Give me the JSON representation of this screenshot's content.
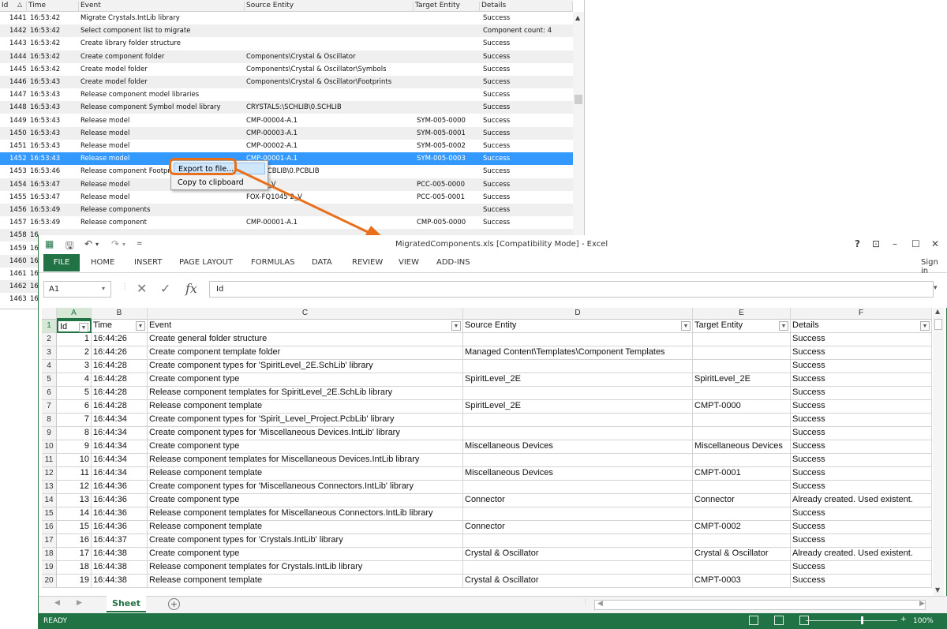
{
  "log": {
    "headers": [
      "Id",
      "Time",
      "Event",
      "Source Entity",
      "Target Entity",
      "Details"
    ],
    "rows": [
      {
        "id": "1441",
        "time": "16:53:42",
        "event": "Migrate Crystals.IntLib library",
        "source": "",
        "target": "",
        "details": "Success"
      },
      {
        "id": "1442",
        "time": "16:53:42",
        "event": "Select component list to migrate",
        "source": "",
        "target": "",
        "details": "Component count: 4"
      },
      {
        "id": "1443",
        "time": "16:53:42",
        "event": "Create library folder structure",
        "source": "",
        "target": "",
        "details": "Success"
      },
      {
        "id": "1444",
        "time": "16:53:42",
        "event": "Create component folder",
        "source": "Components\\Crystal & Oscillator",
        "target": "",
        "details": "Success"
      },
      {
        "id": "1445",
        "time": "16:53:42",
        "event": "Create model folder",
        "source": "Components\\Crystal & Oscillator\\Symbols",
        "target": "",
        "details": "Success"
      },
      {
        "id": "1446",
        "time": "16:53:43",
        "event": "Create model folder",
        "source": "Components\\Crystal & Oscillator\\Footprints",
        "target": "",
        "details": "Success"
      },
      {
        "id": "1447",
        "time": "16:53:43",
        "event": "Release component model libraries",
        "source": "",
        "target": "",
        "details": "Success"
      },
      {
        "id": "1448",
        "time": "16:53:43",
        "event": "Release component Symbol model library",
        "source": "CRYSTALS:\\SCHLIB\\0.SCHLIB",
        "target": "",
        "details": "Success"
      },
      {
        "id": "1449",
        "time": "16:53:43",
        "event": "Release model",
        "source": "CMP-00004-A.1",
        "target": "SYM-005-0000",
        "details": "Success"
      },
      {
        "id": "1450",
        "time": "16:53:43",
        "event": "Release model",
        "source": "CMP-00003-A.1",
        "target": "SYM-005-0001",
        "details": "Success"
      },
      {
        "id": "1451",
        "time": "16:53:43",
        "event": "Release model",
        "source": "CMP-00002-A.1",
        "target": "SYM-005-0002",
        "details": "Success"
      },
      {
        "id": "1452",
        "time": "16:53:43",
        "event": "Release model",
        "source": "CMP-00001-A.1",
        "target": "SYM-005-0003",
        "details": "Success"
      },
      {
        "id": "1453",
        "time": "16:53:46",
        "event": "Release component Footprint",
        "source": "ALS:\\PCBLIB\\0.PCBLIB",
        "target": "",
        "details": "Success"
      },
      {
        "id": "1454",
        "time": "16:53:47",
        "event": "Release model",
        "source": "5032B_V",
        "target": "PCC-005-0000",
        "details": "Success"
      },
      {
        "id": "1455",
        "time": "16:53:47",
        "event": "Release model",
        "source": "FOX-FQ1045 2_V",
        "target": "PCC-005-0001",
        "details": "Success"
      },
      {
        "id": "1456",
        "time": "16:53:49",
        "event": "Release components",
        "source": "",
        "target": "",
        "details": "Success"
      },
      {
        "id": "1457",
        "time": "16:53:49",
        "event": "Release component",
        "source": "CMP-00001-A.1",
        "target": "CMP-005-0000",
        "details": "Success"
      },
      {
        "id": "1458",
        "time": "16",
        "event": "",
        "source": "",
        "target": "",
        "details": ""
      },
      {
        "id": "1459",
        "time": "16",
        "event": "",
        "source": "",
        "target": "",
        "details": ""
      },
      {
        "id": "1460",
        "time": "16",
        "event": "",
        "source": "",
        "target": "",
        "details": ""
      },
      {
        "id": "1461",
        "time": "16",
        "event": "",
        "source": "",
        "target": "",
        "details": ""
      },
      {
        "id": "1462",
        "time": "16",
        "event": "",
        "source": "",
        "target": "",
        "details": ""
      },
      {
        "id": "1463",
        "time": "16",
        "event": "",
        "source": "",
        "target": "",
        "details": ""
      }
    ],
    "selected_row_index": 11,
    "context_menu": [
      "Export to file...",
      "Copy to clipboard"
    ]
  },
  "excel": {
    "title": "MigratedComponents.xls  [Compatibility Mode] - Excel",
    "window_controls": [
      "?",
      "⊡",
      "–",
      "☐",
      "✕"
    ],
    "ribbon_tabs": [
      "FILE",
      "HOME",
      "INSERT",
      "PAGE LAYOUT",
      "FORMULAS",
      "DATA",
      "REVIEW",
      "VIEW",
      "ADD-INS"
    ],
    "sign_in": "Sign in",
    "name_box": "A1",
    "formula": "Id",
    "columns": [
      "A",
      "B",
      "C",
      "D",
      "E",
      "F"
    ],
    "headers": [
      "Id",
      "Time",
      "Event",
      "Source Entity",
      "Target Entity",
      "Details"
    ],
    "rows": [
      [
        "1",
        "16:44:26",
        "Create general folder structure",
        "",
        "",
        "Success"
      ],
      [
        "2",
        "16:44:26",
        "Create component template folder",
        "Managed Content\\Templates\\Component Templates",
        "",
        "Success"
      ],
      [
        "3",
        "16:44:28",
        "Create component types for 'SpiritLevel_2E.SchLib' library",
        "",
        "",
        "Success"
      ],
      [
        "4",
        "16:44:28",
        "Create component type",
        "SpiritLevel_2E",
        "SpiritLevel_2E",
        "Success"
      ],
      [
        "5",
        "16:44:28",
        "Release component templates for SpiritLevel_2E.SchLib library",
        "",
        "",
        "Success"
      ],
      [
        "6",
        "16:44:28",
        "Release component template",
        "SpiritLevel_2E",
        "CMPT-0000",
        "Success"
      ],
      [
        "7",
        "16:44:34",
        "Create component types for 'Spirit_Level_Project.PcbLib' library",
        "",
        "",
        "Success"
      ],
      [
        "8",
        "16:44:34",
        "Create component types for 'Miscellaneous Devices.IntLib' library",
        "",
        "",
        "Success"
      ],
      [
        "9",
        "16:44:34",
        "Create component type",
        "Miscellaneous Devices",
        "Miscellaneous Devices",
        "Success"
      ],
      [
        "10",
        "16:44:34",
        "Release component templates for Miscellaneous Devices.IntLib library",
        "",
        "",
        "Success"
      ],
      [
        "11",
        "16:44:34",
        "Release component template",
        "Miscellaneous Devices",
        "CMPT-0001",
        "Success"
      ],
      [
        "12",
        "16:44:36",
        "Create component types for 'Miscellaneous Connectors.IntLib' library",
        "",
        "",
        "Success"
      ],
      [
        "13",
        "16:44:36",
        "Create component type",
        "Connector",
        "Connector",
        "Already created. Used existent."
      ],
      [
        "14",
        "16:44:36",
        "Release component templates for Miscellaneous Connectors.IntLib library",
        "",
        "",
        "Success"
      ],
      [
        "15",
        "16:44:36",
        "Release component template",
        "Connector",
        "CMPT-0002",
        "Success"
      ],
      [
        "16",
        "16:44:37",
        "Create component types for 'Crystals.IntLib' library",
        "",
        "",
        "Success"
      ],
      [
        "17",
        "16:44:38",
        "Create component type",
        "Crystal & Oscillator",
        "Crystal & Oscillator",
        "Already created. Used existent."
      ],
      [
        "18",
        "16:44:38",
        "Release component templates for Crystals.IntLib library",
        "",
        "",
        "Success"
      ],
      [
        "19",
        "16:44:38",
        "Release component template",
        "Crystal & Oscillator",
        "CMPT-0003",
        "Success"
      ]
    ],
    "sheet_tab": "Sheet",
    "status": "READY",
    "zoom": "100%"
  },
  "colors": {
    "excel_green": "#217346",
    "selection_blue": "#3399ff",
    "highlight_orange": "#e8701c"
  }
}
